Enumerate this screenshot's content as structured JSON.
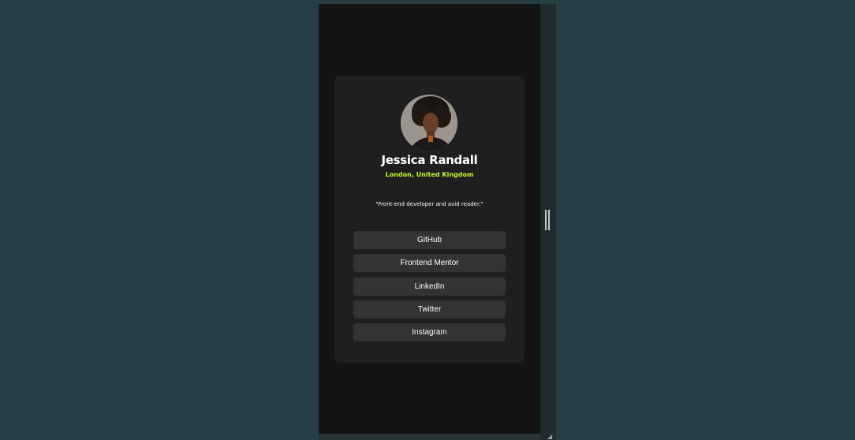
{
  "profile": {
    "name": "Jessica Randall",
    "location": "London, United Kingdom",
    "bio": "\"Front-end developer and avid reader.\""
  },
  "links": [
    {
      "label": "GitHub"
    },
    {
      "label": "Frontend Mentor"
    },
    {
      "label": "LinkedIn"
    },
    {
      "label": "Twitter"
    },
    {
      "label": "Instagram"
    }
  ],
  "colors": {
    "page_background": "#273e44",
    "viewport_background": "#141414",
    "card_background": "#1f1f1f",
    "button_background": "#333333",
    "accent_green": "#c5f82a",
    "text_white": "#ffffff"
  },
  "icons": {
    "resize_handle": "vertical-double-bar",
    "corner_grip": "resize-corner-icon"
  }
}
